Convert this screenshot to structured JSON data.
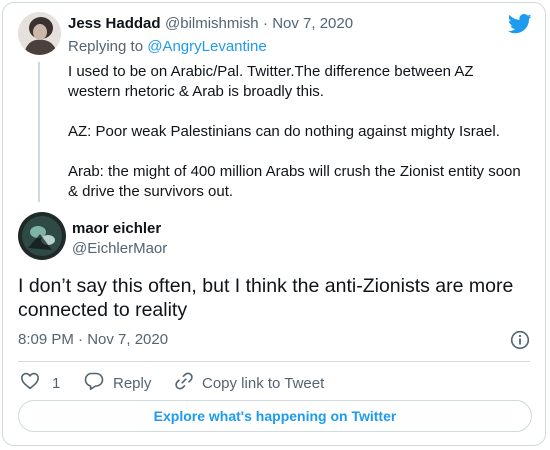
{
  "reply_tweet": {
    "display_name": "Jess Haddad",
    "handle": "@bilmishmish",
    "date": "· Nov 7, 2020",
    "replying_prefix": "Replying to ",
    "replying_to": "@AngryLevantine",
    "paragraphs": [
      "I used to be on Arabic/Pal. Twitter.The difference between AZ western rhetoric & Arab is broadly this.",
      "AZ: Poor weak Palestinians can do nothing against mighty Israel.",
      "Arab: the might of 400 million Arabs will crush the Zionist entity soon & drive the survivors out."
    ]
  },
  "main_tweet": {
    "display_name": "maor eichler",
    "handle": "@EichlerMaor",
    "text": "I don’t say this often, but I think the anti-Zionists are more connected to reality",
    "timestamp": "8:09 PM · Nov 7, 2020"
  },
  "actions": {
    "like_count": "1",
    "reply_label": "Reply",
    "copy_link_label": "Copy link to Tweet"
  },
  "explore_label": "Explore what's happening on Twitter",
  "icons": [
    "twitter-bird-icon",
    "info-icon",
    "heart-icon",
    "reply-icon",
    "link-icon"
  ],
  "colors": {
    "accent": "#1d9bf0",
    "text": "#0f1419",
    "muted": "#536471",
    "border": "#cfd9de"
  }
}
